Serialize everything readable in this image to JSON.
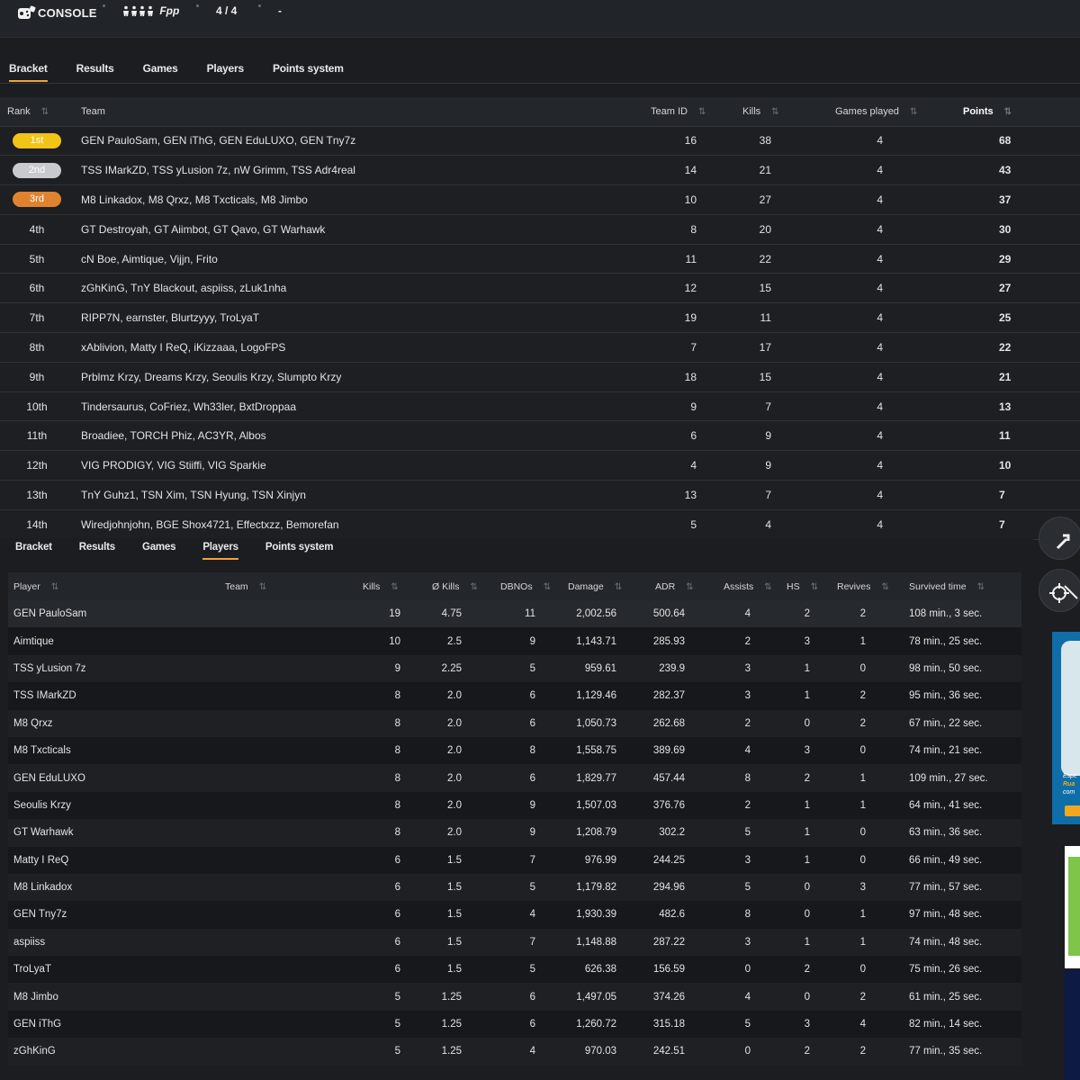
{
  "header": {
    "logo_text": "CONSOLE",
    "game_mode_value": "Fpp",
    "games_value": "4 / 4",
    "teams_value": "-"
  },
  "tabs": [
    "Bracket",
    "Results",
    "Games",
    "Players",
    "Points system"
  ],
  "bracket": {
    "headers": {
      "rank": "Rank",
      "team": "Team",
      "team_id": "Team ID",
      "kills": "Kills",
      "games_played": "Games played",
      "points": "Points"
    },
    "rows": [
      {
        "rank": "1st",
        "team": "GEN PauloSam, GEN iThG, GEN EduLUXO, GEN Tny7z",
        "team_id": "16",
        "kills": "38",
        "games": "4",
        "points": "68"
      },
      {
        "rank": "2nd",
        "team": "TSS IMarkZD, TSS yLusion 7z, nW Grimm, TSS Adr4real",
        "team_id": "14",
        "kills": "21",
        "games": "4",
        "points": "43"
      },
      {
        "rank": "3rd",
        "team": "M8 Linkadox, M8 Qrxz, M8 Txcticals, M8 Jimbo",
        "team_id": "10",
        "kills": "27",
        "games": "4",
        "points": "37"
      },
      {
        "rank": "4th",
        "team": "GT Destroyah, GT Aiimbot, GT Qavo, GT Warhawk",
        "team_id": "8",
        "kills": "20",
        "games": "4",
        "points": "30"
      },
      {
        "rank": "5th",
        "team": "cN Boe, Aimtique, Vijjn, Frito",
        "team_id": "11",
        "kills": "22",
        "games": "4",
        "points": "29"
      },
      {
        "rank": "6th",
        "team": "zGhKinG, TnY Blackout, aspiiss, zLuk1nha",
        "team_id": "12",
        "kills": "15",
        "games": "4",
        "points": "27"
      },
      {
        "rank": "7th",
        "team": "RIPP7N, earnster, Blurtzyyy, TroLyaT",
        "team_id": "19",
        "kills": "11",
        "games": "4",
        "points": "25"
      },
      {
        "rank": "8th",
        "team": "xAblivion, Matty I ReQ, iKizzaaa, LogoFPS",
        "team_id": "7",
        "kills": "17",
        "games": "4",
        "points": "22"
      },
      {
        "rank": "9th",
        "team": "Prblmz Krzy, Dreams Krzy, Seoulis Krzy, Slumpto Krzy",
        "team_id": "18",
        "kills": "15",
        "games": "4",
        "points": "21"
      },
      {
        "rank": "10th",
        "team": "Tindersaurus, CoFriez, Wh33ler, BxtDroppaa",
        "team_id": "9",
        "kills": "7",
        "games": "4",
        "points": "13"
      },
      {
        "rank": "11th",
        "team": "Broadiee, TORCH Phiz, AC3YR, Albos",
        "team_id": "6",
        "kills": "9",
        "games": "4",
        "points": "11"
      },
      {
        "rank": "12th",
        "team": "VIG PRODIGY, VIG Stiiffi, VIG Sparkie",
        "team_id": "4",
        "kills": "9",
        "games": "4",
        "points": "10"
      },
      {
        "rank": "13th",
        "team": "TnY Guhz1, TSN Xim, TSN Hyung, TSN Xinjyn",
        "team_id": "13",
        "kills": "7",
        "games": "4",
        "points": "7"
      },
      {
        "rank": "14th",
        "team": "Wiredjohnjohn, BGE Shox4721, Effectxzz, Bemorefan",
        "team_id": "5",
        "kills": "4",
        "games": "4",
        "points": "7"
      }
    ]
  },
  "players": {
    "headers": {
      "player": "Player",
      "team": "Team",
      "kills": "Kills",
      "avg_kills": "Ø Kills",
      "dbnos": "DBNOs",
      "damage": "Damage",
      "adr": "ADR",
      "assists": "Assists",
      "hs": "HS",
      "revives": "Revives",
      "survived": "Survived time"
    },
    "rows": [
      {
        "player": "GEN PauloSam",
        "kills": "19",
        "avg": "4.75",
        "dbnos": "11",
        "damage": "2,002.56",
        "adr": "500.64",
        "assists": "4",
        "hs": "2",
        "revives": "2",
        "survived": "108 min., 3 sec."
      },
      {
        "player": "Aimtique",
        "kills": "10",
        "avg": "2.5",
        "dbnos": "9",
        "damage": "1,143.71",
        "adr": "285.93",
        "assists": "2",
        "hs": "3",
        "revives": "1",
        "survived": "78 min., 25 sec."
      },
      {
        "player": "TSS yLusion 7z",
        "kills": "9",
        "avg": "2.25",
        "dbnos": "5",
        "damage": "959.61",
        "adr": "239.9",
        "assists": "3",
        "hs": "1",
        "revives": "0",
        "survived": "98 min., 50 sec."
      },
      {
        "player": "TSS IMarkZD",
        "kills": "8",
        "avg": "2.0",
        "dbnos": "6",
        "damage": "1,129.46",
        "adr": "282.37",
        "assists": "3",
        "hs": "1",
        "revives": "2",
        "survived": "95 min., 36 sec."
      },
      {
        "player": "M8 Qrxz",
        "kills": "8",
        "avg": "2.0",
        "dbnos": "6",
        "damage": "1,050.73",
        "adr": "262.68",
        "assists": "2",
        "hs": "0",
        "revives": "2",
        "survived": "67 min., 22 sec."
      },
      {
        "player": "M8 Txcticals",
        "kills": "8",
        "avg": "2.0",
        "dbnos": "8",
        "damage": "1,558.75",
        "adr": "389.69",
        "assists": "4",
        "hs": "3",
        "revives": "0",
        "survived": "74 min., 21 sec."
      },
      {
        "player": "GEN EduLUXO",
        "kills": "8",
        "avg": "2.0",
        "dbnos": "6",
        "damage": "1,829.77",
        "adr": "457.44",
        "assists": "8",
        "hs": "2",
        "revives": "1",
        "survived": "109 min., 27 sec."
      },
      {
        "player": "Seoulis Krzy",
        "kills": "8",
        "avg": "2.0",
        "dbnos": "9",
        "damage": "1,507.03",
        "adr": "376.76",
        "assists": "2",
        "hs": "1",
        "revives": "1",
        "survived": "64 min., 41 sec."
      },
      {
        "player": "GT Warhawk",
        "kills": "8",
        "avg": "2.0",
        "dbnos": "9",
        "damage": "1,208.79",
        "adr": "302.2",
        "assists": "5",
        "hs": "1",
        "revives": "0",
        "survived": "63 min., 36 sec."
      },
      {
        "player": "Matty I ReQ",
        "kills": "6",
        "avg": "1.5",
        "dbnos": "7",
        "damage": "976.99",
        "adr": "244.25",
        "assists": "3",
        "hs": "1",
        "revives": "0",
        "survived": "66 min., 49 sec."
      },
      {
        "player": "M8 Linkadox",
        "kills": "6",
        "avg": "1.5",
        "dbnos": "5",
        "damage": "1,179.82",
        "adr": "294.96",
        "assists": "5",
        "hs": "0",
        "revives": "3",
        "survived": "77 min., 57 sec."
      },
      {
        "player": "GEN Tny7z",
        "kills": "6",
        "avg": "1.5",
        "dbnos": "4",
        "damage": "1,930.39",
        "adr": "482.6",
        "assists": "8",
        "hs": "0",
        "revives": "1",
        "survived": "97 min., 48 sec."
      },
      {
        "player": "aspiiss",
        "kills": "6",
        "avg": "1.5",
        "dbnos": "7",
        "damage": "1,148.88",
        "adr": "287.22",
        "assists": "3",
        "hs": "1",
        "revives": "1",
        "survived": "74 min., 48 sec."
      },
      {
        "player": "TroLyaT",
        "kills": "6",
        "avg": "1.5",
        "dbnos": "5",
        "damage": "626.38",
        "adr": "156.59",
        "assists": "0",
        "hs": "2",
        "revives": "0",
        "survived": "75 min., 26 sec."
      },
      {
        "player": "M8 Jimbo",
        "kills": "5",
        "avg": "1.25",
        "dbnos": "6",
        "damage": "1,497.05",
        "adr": "374.26",
        "assists": "4",
        "hs": "0",
        "revives": "2",
        "survived": "61 min., 25 sec."
      },
      {
        "player": "GEN iThG",
        "kills": "5",
        "avg": "1.25",
        "dbnos": "6",
        "damage": "1,260.72",
        "adr": "315.18",
        "assists": "5",
        "hs": "3",
        "revives": "4",
        "survived": "82 min., 14 sec."
      },
      {
        "player": "zGhKinG",
        "kills": "5",
        "avg": "1.25",
        "dbnos": "4",
        "damage": "970.03",
        "adr": "242.51",
        "assists": "0",
        "hs": "2",
        "revives": "2",
        "survived": "77 min., 35 sec."
      }
    ]
  },
  "colors": {
    "accent": "#f0a33a",
    "gold": "#f2c417",
    "silver": "#c9cacc",
    "bronze": "#e0832f",
    "background": "#1b1d21"
  }
}
